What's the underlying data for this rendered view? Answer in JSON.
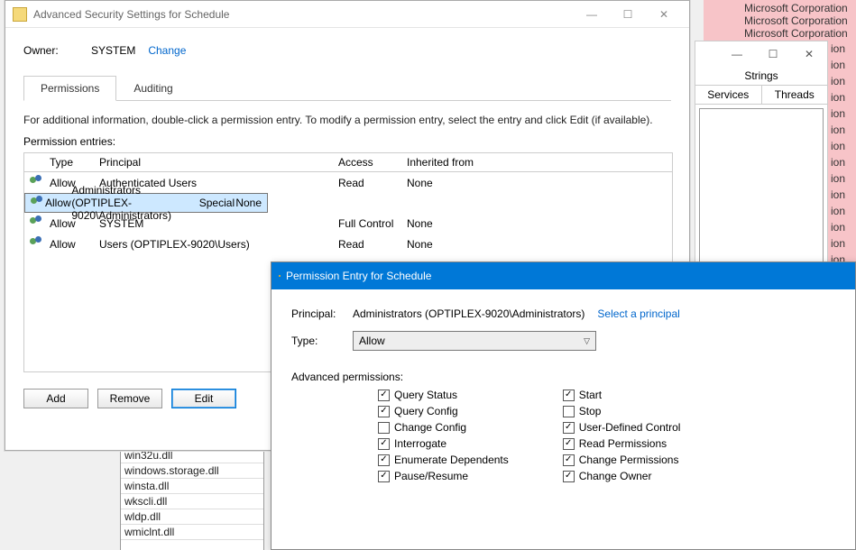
{
  "bg": {
    "corp_line": "Microsoft Corporation",
    "ion": "ion"
  },
  "win2": {
    "strings_header": "Strings",
    "tab_services": "Services",
    "tab_threads": "Threads"
  },
  "dlls": [
    "win32u.dll",
    "windows.storage.dll",
    "winsta.dll",
    "wkscli.dll",
    "wldp.dll",
    "wmiclnt.dll"
  ],
  "dlg1": {
    "title": "Advanced Security Settings for Schedule",
    "owner_label": "Owner:",
    "owner_value": "SYSTEM",
    "change": "Change",
    "tab_perm": "Permissions",
    "tab_audit": "Auditing",
    "info": "For additional information, double-click a permission entry. To modify a permission entry, select the entry and click Edit (if available).",
    "perm_entries": "Permission entries:",
    "hdr": {
      "type": "Type",
      "principal": "Principal",
      "access": "Access",
      "inh": "Inherited from"
    },
    "rows": [
      {
        "type": "Allow",
        "principal": "Authenticated Users",
        "access": "Read",
        "inh": "None",
        "sel": false
      },
      {
        "type": "Allow",
        "principal": "Administrators (OPTIPLEX-9020\\Administrators)",
        "access": "Special",
        "inh": "None",
        "sel": true
      },
      {
        "type": "Allow",
        "principal": "SYSTEM",
        "access": "Full Control",
        "inh": "None",
        "sel": false
      },
      {
        "type": "Allow",
        "principal": "Users (OPTIPLEX-9020\\Users)",
        "access": "Read",
        "inh": "None",
        "sel": false
      }
    ],
    "btn_add": "Add",
    "btn_remove": "Remove",
    "btn_edit": "Edit"
  },
  "dlg2": {
    "title": "Permission Entry for Schedule",
    "principal_label": "Principal:",
    "principal_value": "Administrators (OPTIPLEX-9020\\Administrators)",
    "select_principal": "Select a principal",
    "type_label": "Type:",
    "type_value": "Allow",
    "adv_label": "Advanced permissions:",
    "col1": [
      {
        "label": "Query Status",
        "checked": true
      },
      {
        "label": "Query Config",
        "checked": true
      },
      {
        "label": "Change Config",
        "checked": false
      },
      {
        "label": "Interrogate",
        "checked": true
      },
      {
        "label": "Enumerate Dependents",
        "checked": true
      },
      {
        "label": "Pause/Resume",
        "checked": true
      }
    ],
    "col2": [
      {
        "label": "Start",
        "checked": true
      },
      {
        "label": "Stop",
        "checked": false
      },
      {
        "label": "User-Defined Control",
        "checked": true
      },
      {
        "label": "Read Permissions",
        "checked": true
      },
      {
        "label": "Change Permissions",
        "checked": true
      },
      {
        "label": "Change Owner",
        "checked": true
      }
    ]
  }
}
